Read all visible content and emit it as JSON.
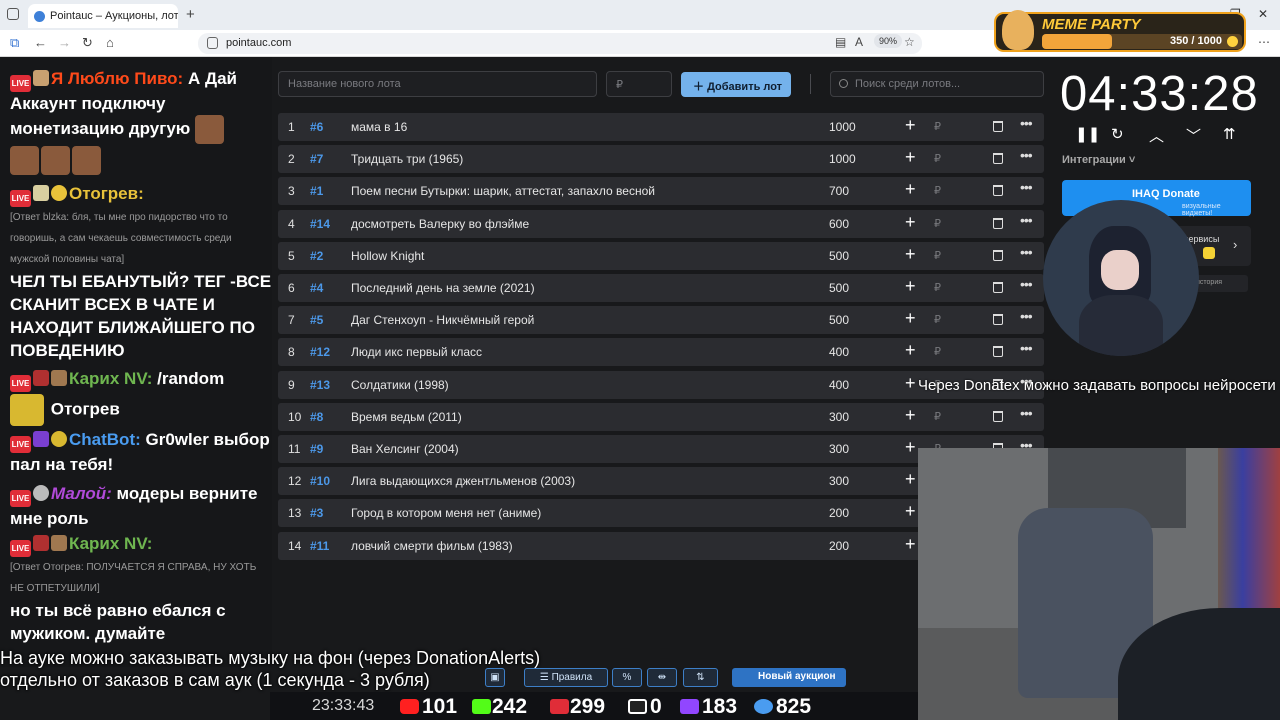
{
  "browser": {
    "tab_title": "Pointauc – Аукционы, лотереи",
    "url": "pointauc.com",
    "zoom": "90%"
  },
  "widget": {
    "title": "MEME PARTY",
    "counter": "350 / 1000",
    "progress": 0.35
  },
  "chat": {
    "messages": [
      {
        "user": "Я Люблю Пиво:",
        "text": "А Дай Аккаунт подключу монетизацию другую",
        "user_color": "#ff4a1a"
      },
      {
        "user": "Отогрев:",
        "reply": "[Ответ blzka: бля, ты мне про пидорство что то говоришь, а сам чекаешь совместимость среди мужской половины чата]",
        "text": "ЧЕЛ ТЫ ЕБАНУТЫЙ? ТЕГ -ВСЕ СКАНИТ ВСЕХ В ЧАТЕ И НАХОДИТ БЛИЖАЙШЕГО ПО ПОВЕДЕНИЮ",
        "user_color": "#e8c23a"
      },
      {
        "user": "Карих NV:",
        "text": "/random",
        "mention": "Отогрев",
        "user_color": "#6fb650"
      },
      {
        "user": "ChatBot:",
        "text": "Gr0wler выбор пал на тебя!",
        "user_color": "#4a9cf0"
      },
      {
        "user": "Малой:",
        "text": "модеры верните мне роль",
        "user_color": "#b04ad8"
      },
      {
        "user": "Карих NV:",
        "reply": "[Ответ Отогрев: ПОЛУЧАЕТСЯ Я СПРАВА, НУ ХОТЬ НЕ ОТПЕТУШИЛИ]",
        "text": "но ты всё равно ебался с мужиком. думайте",
        "user_color": "#6fb650"
      }
    ]
  },
  "auction": {
    "new_lot_placeholder": "Название нового лота",
    "amount_placeholder": "₽",
    "add_button": "Добавить лот",
    "search_placeholder": "Поиск среди лотов...",
    "currency": "₽",
    "lots": [
      {
        "n": "1",
        "id": "#6",
        "name": "мама в 16",
        "amount": "1000"
      },
      {
        "n": "2",
        "id": "#7",
        "name": "Тридцать три (1965)",
        "amount": "1000"
      },
      {
        "n": "3",
        "id": "#1",
        "name": "Поем песни Бутырки: шарик, аттестат, запахло весной",
        "amount": "700"
      },
      {
        "n": "4",
        "id": "#14",
        "name": "досмотреть Валерку во флэйме",
        "amount": "600"
      },
      {
        "n": "5",
        "id": "#2",
        "name": "Hollow Knight",
        "amount": "500"
      },
      {
        "n": "6",
        "id": "#4",
        "name": "Последний день на земле (2021)",
        "amount": "500"
      },
      {
        "n": "7",
        "id": "#5",
        "name": "Даг Стенхоуп - Никчёмный герой",
        "amount": "500"
      },
      {
        "n": "8",
        "id": "#12",
        "name": "Люди икс первый класс",
        "amount": "400"
      },
      {
        "n": "9",
        "id": "#13",
        "name": "Солдатики (1998)",
        "amount": "400"
      },
      {
        "n": "10",
        "id": "#8",
        "name": "Время ведьм (2011)",
        "amount": "300"
      },
      {
        "n": "11",
        "id": "#9",
        "name": "Ван Хелсинг (2004)",
        "amount": "300"
      },
      {
        "n": "12",
        "id": "#10",
        "name": "Лига выдающихся джентльменов (2003)",
        "amount": "300"
      },
      {
        "n": "13",
        "id": "#3",
        "name": "Город в котором меня нет (аниме)",
        "amount": "200"
      },
      {
        "n": "14",
        "id": "#11",
        "name": "ловчий смерти фильм (1983)",
        "amount": "200"
      }
    ]
  },
  "timer": {
    "value": "04:33:28",
    "integrations_label": "Интеграции",
    "donate_title": "IHAQ Donate",
    "donate_sub": "визуальные виджеты!",
    "card2_label": "сервисы",
    "card3_label": "история"
  },
  "overlay": {
    "neuro_text": "Через Donatex можно задавать вопросы нейросети",
    "caption1": "На ауке можно заказывать музыку на фон (через DonationAlerts)",
    "caption2": "отдельно от заказов в сам аук (1 секунда - 3 рубля)"
  },
  "toolbar": {
    "rules": "Правила",
    "percent": "%",
    "new_auction": "Новый аукцион"
  },
  "stats": {
    "time": "23:33:43",
    "youtube": "101",
    "kick": "242",
    "vk": "299",
    "rutube": "0",
    "twitch": "183",
    "viewers": "825"
  }
}
